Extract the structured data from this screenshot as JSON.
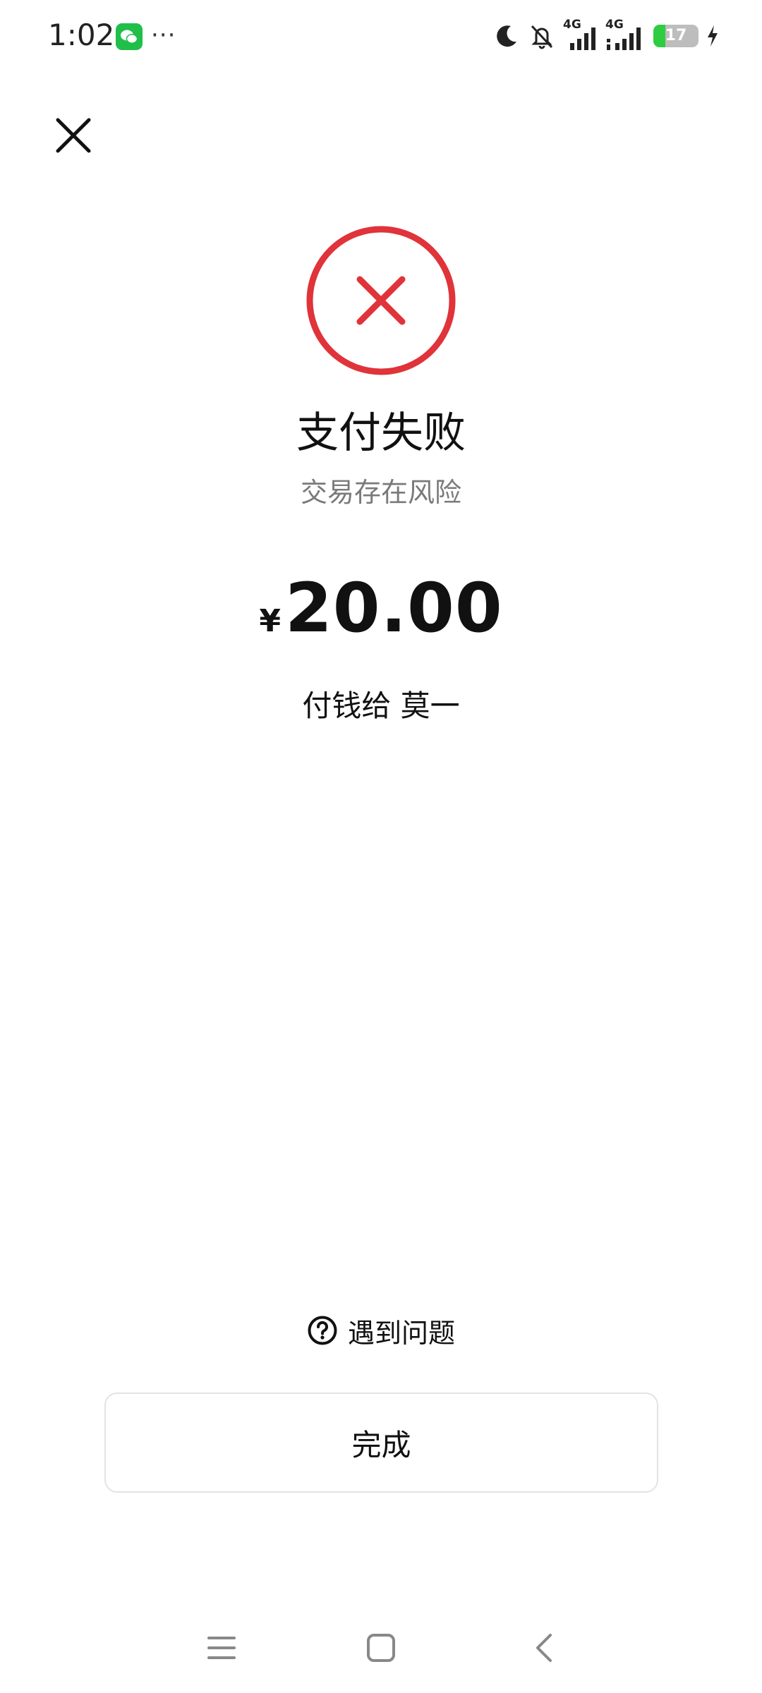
{
  "status_bar": {
    "time": "1:02",
    "dots": "···",
    "net1_label": "4G",
    "net2_label": "4G",
    "battery_level": "17",
    "battery_fraction": 0.17,
    "app_icon": "wechat-icon",
    "icons": [
      "moon-icon",
      "bell-off-icon",
      "signal-icon",
      "signal-icon",
      "battery-icon",
      "charging-icon"
    ]
  },
  "page": {
    "close_icon": "close-icon",
    "result_icon": "error-circle-icon",
    "title": "支付失败",
    "subtitle": "交易存在风险",
    "currency_symbol": "¥",
    "amount": "20.00",
    "payee_text": "付钱给 莫一",
    "help_text": "遇到问题",
    "help_icon": "question-circle-icon",
    "done_label": "完成"
  },
  "colors": {
    "error_red": "#e0333a",
    "border": "#e3e3e3",
    "subtitle": "#7a7a7a",
    "wechat_green": "#1fbf4a",
    "battery_green": "#2ecc40"
  },
  "nav_bar": {
    "items": [
      "menu-icon",
      "home-icon",
      "back-icon"
    ]
  }
}
